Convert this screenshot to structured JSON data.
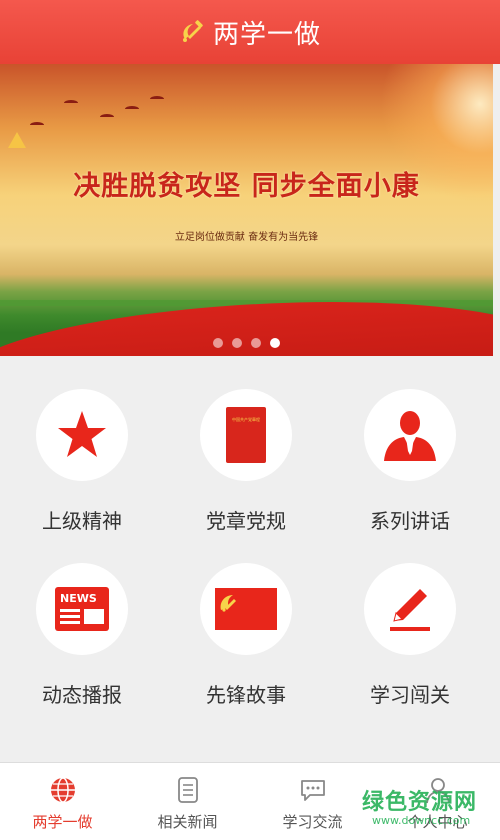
{
  "header": {
    "title": "两学一做",
    "logo_icon": "hammer-sickle-icon",
    "bg_color": "#e84236"
  },
  "banner": {
    "headline": "决胜脱贫攻坚  同步全面小康",
    "subline": "立足岗位做贡献   奋发有为当先锋",
    "slide_count": 4,
    "active_slide": 4
  },
  "modules": [
    {
      "label": "上级精神",
      "icon": "red-star-icon"
    },
    {
      "label": "党章党规",
      "icon": "party-constitution-book-icon",
      "book_title": "中国共产党章程"
    },
    {
      "label": "系列讲话",
      "icon": "speaker-person-icon"
    },
    {
      "label": "动态播报",
      "icon": "news-icon",
      "icon_text": "NEWS"
    },
    {
      "label": "先锋故事",
      "icon": "party-flag-icon"
    },
    {
      "label": "学习闯关",
      "icon": "pencil-icon"
    }
  ],
  "tabs": [
    {
      "label": "两学一做",
      "icon": "globe-icon",
      "active": true
    },
    {
      "label": "相关新闻",
      "icon": "document-icon",
      "active": false
    },
    {
      "label": "学习交流",
      "icon": "chat-bubble-icon",
      "active": false
    },
    {
      "label": "个人中心",
      "icon": "person-icon",
      "active": false
    }
  ],
  "watermark": {
    "text": "绿色资源网",
    "url": "www.downcc.com",
    "color": "#2bb35b"
  },
  "accent_color": "#e43d2f"
}
